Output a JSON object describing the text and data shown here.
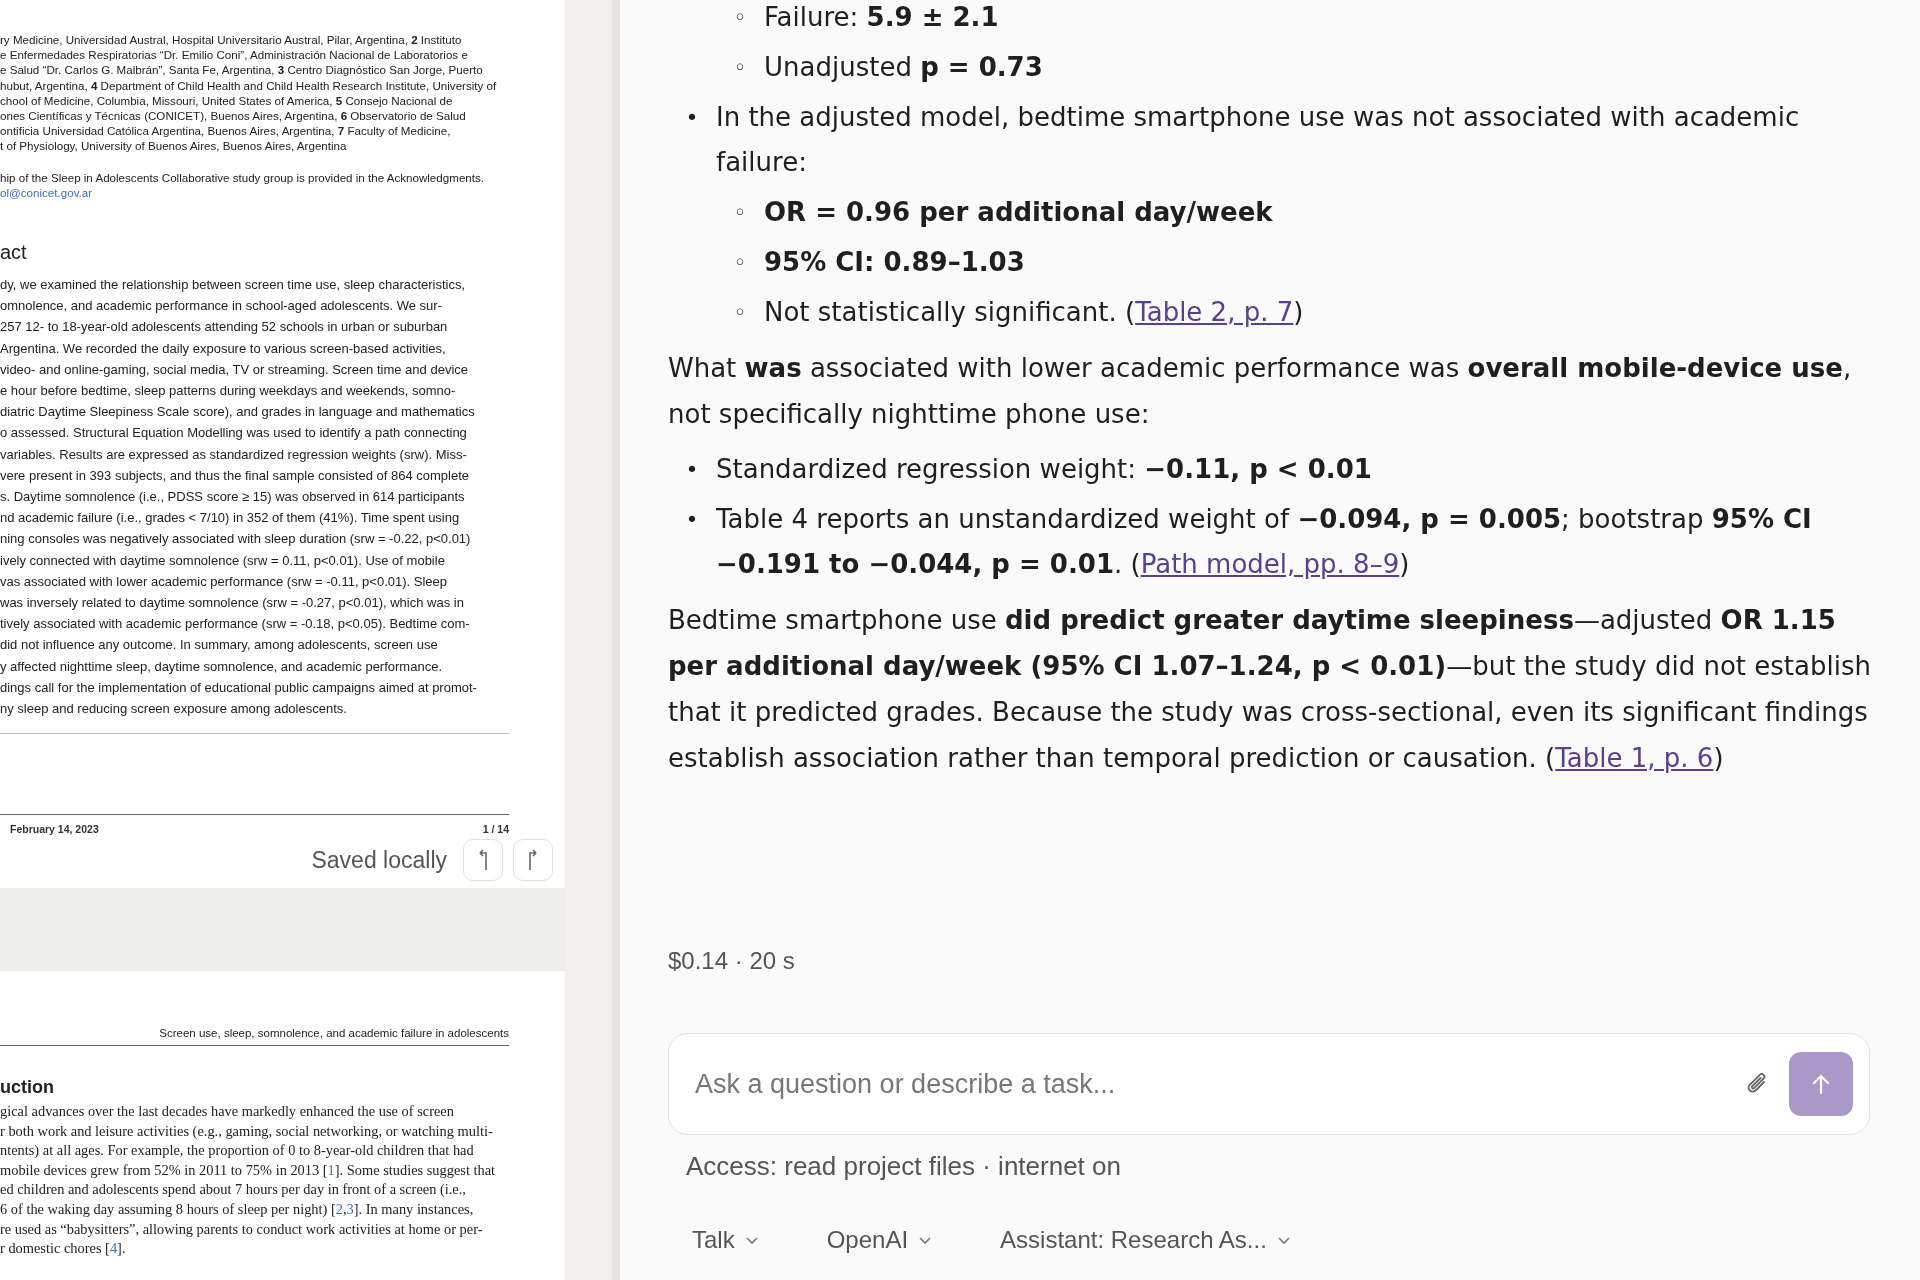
{
  "document_viewer": {
    "page_1": {
      "affiliations": [
        "ry Medicine, Universidad Austral, Hospital Universitario Austral, Pilar, Argentina, **2**  Instituto",
        "e Enfermedades Respiratorias “Dr. Emilio Coni”, Administración Nacional de Laboratorios e",
        "e Salud “Dr. Carlos G. Malbrán”, Santa Fe, Argentina, **3**  Centro Diagnóstico San Jorge, Puerto",
        "hubut, Argentina, **4**  Department of Child Health and Child Health Research Institute, University of",
        "chool of Medicine, Columbia, Missouri, United States of America, **5**  Consejo Nacional de",
        "ones Científicas y Técnicas (CONICET), Buenos Aires, Argentina, **6**  Observatorio de Salud",
        "ontificia Universidad Católica Argentina, Buenos Aires, Argentina, **7**  Faculty of Medicine,",
        "t of Physiology, University of Buenos Aires, Buenos Aires, Argentina"
      ],
      "group_note": "hip of the Sleep in Adolescents Collaborative study group is provided in the Acknowledgments.",
      "email": "ol@conicet.gov.ar",
      "abstract_heading": "act",
      "abstract": [
        "dy, we examined the relationship between screen time use, sleep characteristics,",
        "omnolence, and academic performance in school-aged adolescents. We sur-",
        "257 12- to 18-year-old adolescents attending 52 schools in urban or suburban",
        "Argentina. We recorded the daily exposure to various screen-based activities,",
        "video- and online-gaming, social media, TV or streaming. Screen time and device",
        "e hour before bedtime, sleep patterns during weekdays and weekends, somno-",
        "diatric Daytime Sleepiness Scale score), and grades in language and mathematics",
        "o assessed. Structural Equation Modelling was used to identify a path connecting",
        " variables. Results are expressed as standardized regression weights (srw). Miss-",
        "vere present in 393 subjects, and thus the final sample consisted of 864 complete",
        "s. Daytime somnolence (i.e., PDSS score ≥ 15) was observed in 614 participants",
        "nd academic failure (i.e., grades < 7/10) in 352 of them (41%). Time spent using",
        "ning consoles was negatively associated with sleep duration (srw = -0.22, p<0.01)",
        "ively connected with daytime somnolence (srw = 0.11, p<0.01). Use of mobile",
        "vas associated with lower academic performance (srw = -0.11, p<0.01). Sleep",
        "was inversely related to daytime somnolence (srw = -0.27, p<0.01), which was in",
        "tively associated with academic performance (srw = -0.18, p<0.05). Bedtime com-",
        " did not influence any outcome. In summary, among adolescents, screen use",
        "y affected nighttime sleep, daytime somnolence, and academic performance.",
        "dings call for the implementation of educational public campaigns aimed at promot-",
        "ny sleep and reducing screen exposure among adolescents."
      ],
      "footer_date": "February 14, 2023",
      "page_number": "1 / 14"
    },
    "save_status": "Saved locally",
    "page_2": {
      "running_header": "Screen use, sleep, somnolence, and academic failure in adolescents",
      "section_heading": "uction",
      "body": [
        [
          {
            "t": "gical advances over the last decades have markedly enhanced the use of screen"
          }
        ],
        [
          {
            "t": "r both work and leisure activities (e.g., gaming, social networking, or watching multi-"
          }
        ],
        [
          {
            "t": "ntents) at all ages. For example, the proportion of 0 to 8-year-old children that had"
          }
        ],
        [
          {
            "t": "mobile devices grew from 52% in 2011 to 75% in 2013 ["
          },
          {
            "t": "1",
            "link": true
          },
          {
            "t": "]. Some studies suggest that"
          }
        ],
        [
          {
            "t": "ed children and adolescents spend about 7 hours per day in front of a screen (i.e.,"
          }
        ],
        [
          {
            "t": "6 of the waking day assuming 8 hours of sleep per night) ["
          },
          {
            "t": "2",
            "link": true
          },
          {
            "t": ","
          },
          {
            "t": "3",
            "link": true
          },
          {
            "t": "]. In many instances,"
          }
        ],
        [
          {
            "t": "re used as “babysitters”, allowing parents to conduct work activities at home or per-"
          }
        ],
        [
          {
            "t": "r domestic chores ["
          },
          {
            "t": "4",
            "link": true
          },
          {
            "t": "]."
          }
        ]
      ]
    }
  },
  "chat": {
    "blocks": [
      {
        "kind": "sublist",
        "items": [
          {
            "marker": "◦",
            "text": "Failure: **5.9 ± 2.1**",
            "strong": false
          },
          {
            "marker": "◦",
            "text": "Unadjusted **p = 0.73**",
            "strong": false
          }
        ]
      },
      {
        "kind": "bullets",
        "items": [
          {
            "marker": "•",
            "text": "In the adjusted model, bedtime smartphone use was not associated with academic failure:",
            "children": [
              {
                "marker": "◦",
                "text": "OR = 0.96 per additional day/week",
                "strong": true
              },
              {
                "marker": "◦",
                "text": "95% CI: 0.89–1.03",
                "strong": true
              },
              {
                "marker": "◦",
                "text": "Not statistically significant. (",
                "strong": false,
                "link": "Table 2, p. 7",
                "after": ")"
              }
            ]
          }
        ]
      },
      {
        "kind": "paragraph",
        "text": "What **was** associated with lower academic performance was **overall mobile-device use**, not specifically nighttime phone use:"
      },
      {
        "kind": "bullets",
        "items": [
          {
            "marker": "•",
            "text": "Standardized regression weight: **−0.11, p < 0.01**"
          },
          {
            "marker": "•",
            "text": "Table 4 reports an unstandardized weight of **−0.094, p = 0.005**; bootstrap **95% CI −0.191 to −0.044, p = 0.01**. (",
            "link": "Path model, pp. 8–9",
            "after": ")"
          }
        ]
      },
      {
        "kind": "paragraph",
        "text": "Bedtime smartphone use **did predict greater daytime sleepiness**—adjusted **OR 1.15 per additional day/week (95% CI 1.07–1.24, p < 0.01)**—but the study did not establish that it predicted grades. Because the study was cross-sectional, even its significant findings establish association rather than temporal prediction or causation. (",
        "link": "Table 1, p. 6",
        "after": ")"
      }
    ],
    "meta": "$0.14 · 20 s",
    "composer": {
      "placeholder": "Ask a question or describe a task..."
    },
    "access_note": "Access: read project files · internet on",
    "selectors": [
      {
        "label": "Talk"
      },
      {
        "label": "OpenAI"
      },
      {
        "label": "Assistant: Research As..."
      }
    ]
  }
}
